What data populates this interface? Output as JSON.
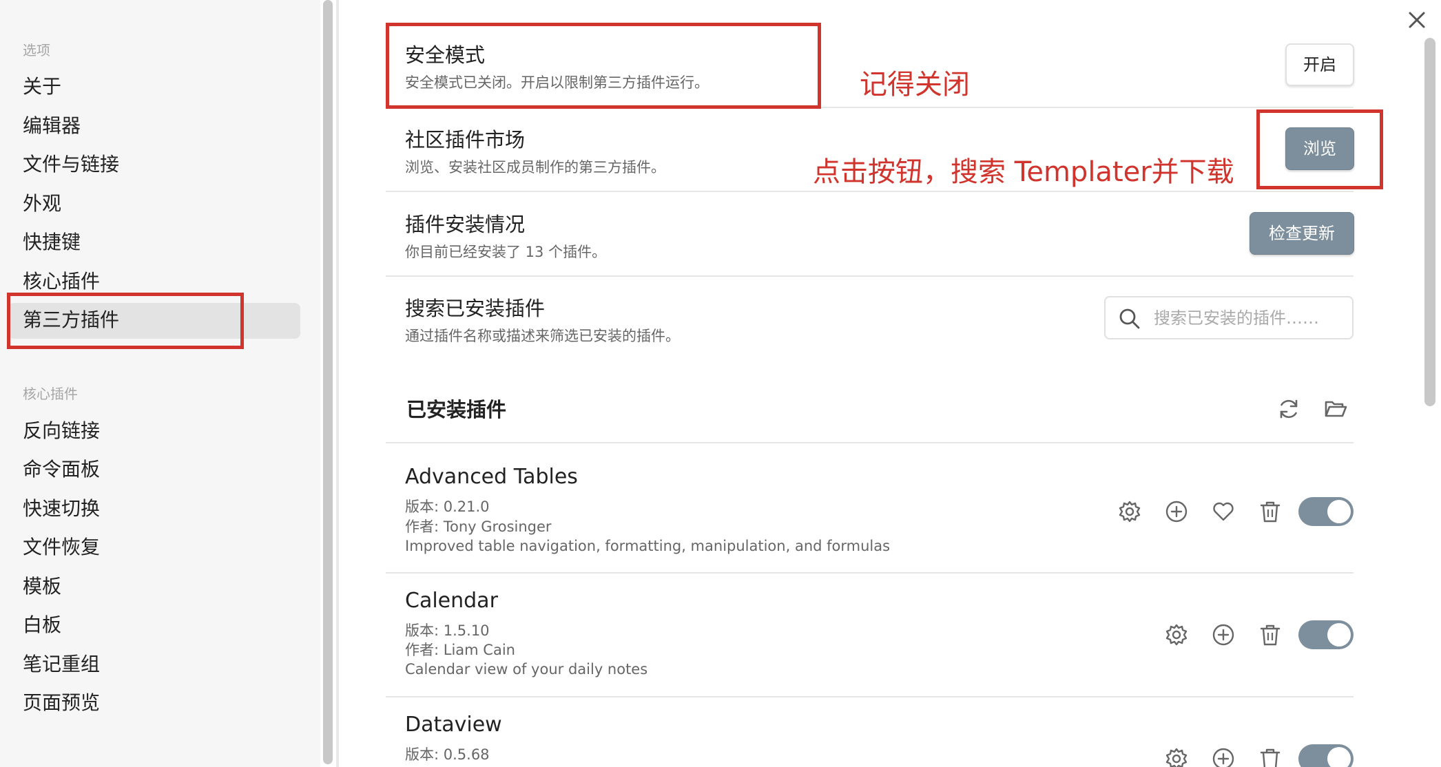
{
  "sidebar": {
    "options_heading": "选项",
    "options_items": [
      "关于",
      "编辑器",
      "文件与链接",
      "外观",
      "快捷键",
      "核心插件",
      "第三方插件"
    ],
    "core_heading": "核心插件",
    "core_items": [
      "反向链接",
      "命令面板",
      "快速切换",
      "文件恢复",
      "模板",
      "白板",
      "笔记重组",
      "页面预览"
    ]
  },
  "settings": {
    "safe_mode": {
      "title": "安全模式",
      "desc": "安全模式已关闭。开启以限制第三方插件运行。",
      "button": "开启"
    },
    "community": {
      "title": "社区插件市场",
      "desc": "浏览、安装社区成员制作的第三方插件。",
      "button": "浏览"
    },
    "status": {
      "title": "插件安装情况",
      "desc": "你目前已经安装了 13 个插件。",
      "button": "检查更新"
    },
    "search": {
      "title": "搜索已安装插件",
      "desc": "通过插件名称或描述来筛选已安装的插件。",
      "placeholder": "搜索已安装的插件……"
    }
  },
  "installed": {
    "title": "已安装插件",
    "plugins": [
      {
        "name": "Advanced Tables",
        "version": "版本: 0.21.0",
        "author": "作者: Tony Grosinger",
        "desc": "Improved table navigation, formatting, manipulation, and formulas",
        "enabled": true
      },
      {
        "name": "Calendar",
        "version": "版本: 1.5.10",
        "author": "作者: Liam Cain",
        "desc": "Calendar view of your daily notes",
        "enabled": true
      },
      {
        "name": "Dataview",
        "version": "版本: 0.5.68",
        "enabled": true
      }
    ]
  },
  "annotations": {
    "remember_close": "记得关闭",
    "click_search": "点击按钮，搜索 Templater并下载"
  },
  "colors": {
    "accent": "#7d8e9c",
    "annotation_red": "#d0342c"
  }
}
